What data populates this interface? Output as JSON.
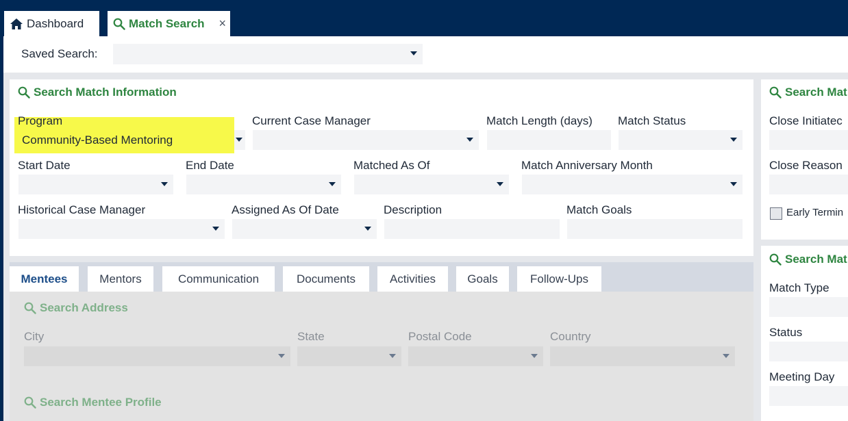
{
  "tabs": {
    "dashboard": {
      "label": "Dashboard",
      "icon": "home-icon"
    },
    "match_search": {
      "label": "Match Search",
      "icon": "search-icon",
      "close": "×"
    }
  },
  "saved_search": {
    "label": "Saved Search:",
    "value": ""
  },
  "match_info": {
    "title": "Search Match Information",
    "program": {
      "label": "Program",
      "value": "Community-Based Mentoring"
    },
    "current_case_manager": {
      "label": "Current Case Manager",
      "value": ""
    },
    "match_length": {
      "label": "Match Length (days)",
      "value": ""
    },
    "match_status": {
      "label": "Match Status",
      "value": ""
    },
    "start_date": {
      "label": "Start Date",
      "value": ""
    },
    "end_date": {
      "label": "End Date",
      "value": ""
    },
    "matched_as_of": {
      "label": "Matched As Of",
      "value": ""
    },
    "anniversary_month": {
      "label": "Match Anniversary Month",
      "value": ""
    },
    "historical_case_manager": {
      "label": "Historical Case Manager",
      "value": ""
    },
    "assigned_as_of": {
      "label": "Assigned As Of Date",
      "value": ""
    },
    "description": {
      "label": "Description",
      "value": ""
    },
    "match_goals": {
      "label": "Match Goals",
      "value": ""
    }
  },
  "right_panel_1": {
    "title": "Search Mat",
    "close_initiated": {
      "label": "Close Initiatec"
    },
    "close_reason": {
      "label": "Close Reason"
    },
    "early_termination": {
      "label": "Early Termin"
    }
  },
  "right_panel_2": {
    "title": "Search Mat",
    "match_type": {
      "label": "Match Type"
    },
    "status": {
      "label": "Status"
    },
    "meeting_day": {
      "label": "Meeting Day"
    }
  },
  "subtabs": [
    {
      "label": "Mentees",
      "active": true
    },
    {
      "label": "Mentors"
    },
    {
      "label": "Communication"
    },
    {
      "label": "Documents"
    },
    {
      "label": "Activities"
    },
    {
      "label": "Goals"
    },
    {
      "label": "Follow-Ups"
    }
  ],
  "mentee_address": {
    "title": "Search Address",
    "city": {
      "label": "City"
    },
    "state": {
      "label": "State"
    },
    "postal_code": {
      "label": "Postal Code"
    },
    "country": {
      "label": "Country"
    }
  },
  "mentee_profile": {
    "title": "Search Mentee Profile"
  },
  "colors": {
    "navy": "#002855",
    "green": "#2e8540",
    "highlight": "#f7f94a",
    "active_tab": "#1d4e89"
  }
}
